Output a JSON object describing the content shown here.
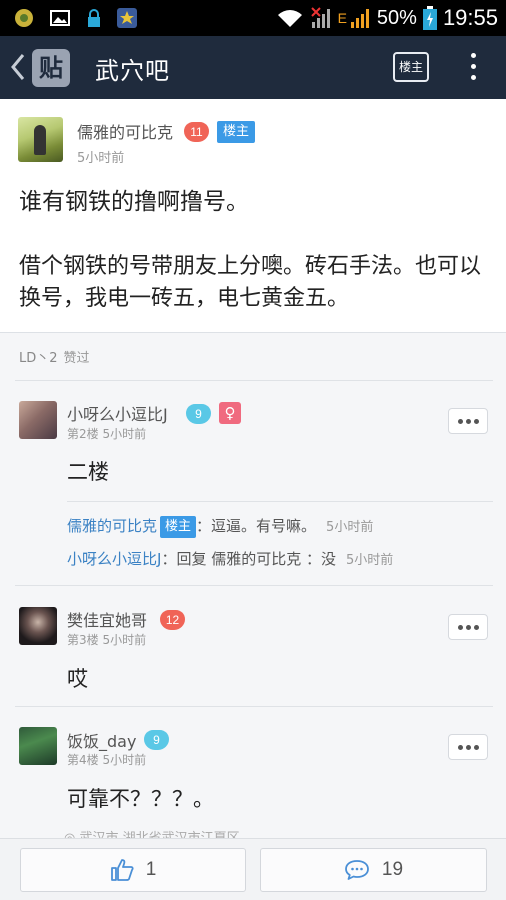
{
  "status_bar": {
    "battery": "50%",
    "time": "19:55",
    "network_label": "E",
    "icons": [
      "app-icon",
      "gallery-icon",
      "lock-icon",
      "star-app-icon",
      "wifi-icon",
      "signal-icon",
      "battery-icon"
    ]
  },
  "header": {
    "logo_text": "贴",
    "title": "武穴吧",
    "louzhu_button": "楼主"
  },
  "original_post": {
    "username": "儒雅的可比克",
    "level": "11",
    "louzhu_tag": "楼主",
    "time": "5小时前",
    "title": "谁有钢铁的撸啊撸号。",
    "body": "借个钢铁的号带朋友上分噢。砖石手法。也可以换号，我电一砖五，电七黄金五。"
  },
  "likes": {
    "users": "LD丶2",
    "label": "赞过"
  },
  "replies": [
    {
      "username": "小呀么小逗比J",
      "level": "9",
      "gender": "♀",
      "floor": "第2楼",
      "time": "5小时前",
      "content": "二楼",
      "sub_replies": [
        {
          "name": "儒雅的可比克",
          "tag": "楼主",
          "text": "：逗逼。有号嘛。",
          "time": "5小时前"
        },
        {
          "name": "小呀么小逗比J",
          "text": "：回复 儒雅的可比克 ：没",
          "time": "5小时前"
        }
      ]
    },
    {
      "username": "樊佳宜她哥",
      "level": "12",
      "floor": "第3楼",
      "time": "5小时前",
      "content": "哎"
    },
    {
      "username": "饭饭_day",
      "level": "9",
      "floor": "第4楼",
      "time": "5小时前",
      "content": "可靠不？？？。",
      "location": "◎ 武汉市 湖北省武汉市江夏区"
    }
  ],
  "bottom_bar": {
    "like_count": "1",
    "comment_count": "19"
  },
  "colors": {
    "header_bg": "#1f2b3d",
    "louzhu_tag": "#3b9ae6",
    "level_red": "#f06457",
    "level_blue": "#5ac8e6",
    "link_blue": "#3b82c4"
  }
}
